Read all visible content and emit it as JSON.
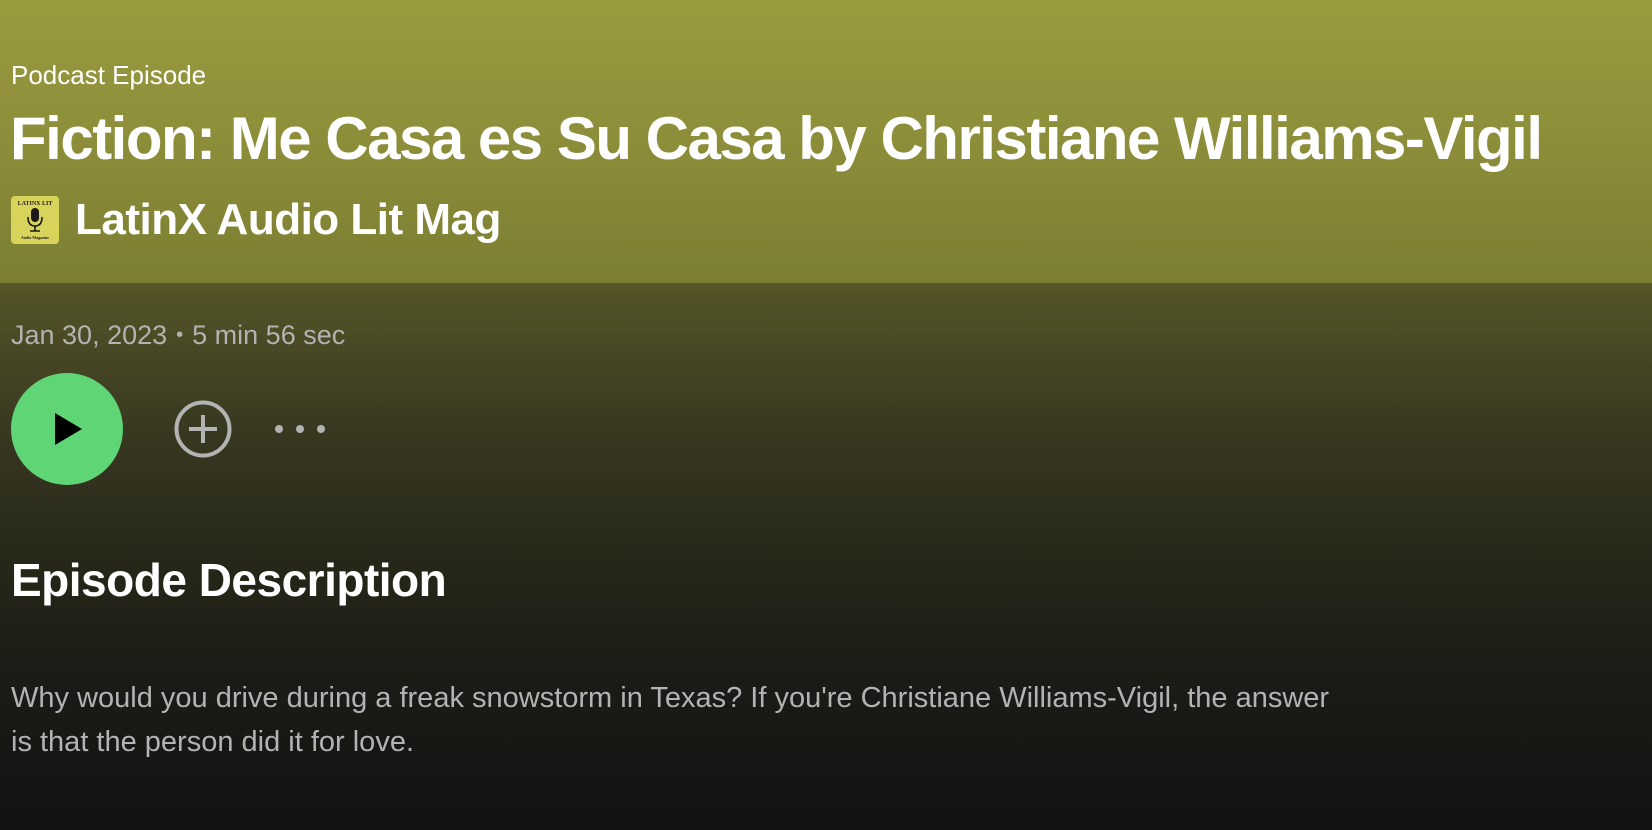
{
  "episode": {
    "eyebrow": "Podcast Episode",
    "title": "Fiction: Me Casa es Su Casa by Christiane Williams-Vigil",
    "show_name": "LatinX Audio Lit Mag",
    "show_art": {
      "top_text": "LATINX LIT",
      "bottom_text": "Audio Magazine",
      "icon": "microphone-icon",
      "background": "#d8d35a"
    },
    "date": "Jan 30, 2023",
    "separator": "•",
    "duration": "5 min 56 sec"
  },
  "controls": {
    "play_icon": "play-icon",
    "add_icon": "plus-circle-icon",
    "more_icon": "more-horizontal-icon",
    "play_color": "#5fd575"
  },
  "description": {
    "heading": "Episode Description",
    "text": "Why would you drive during a freak snowstorm in Texas? If you're Christiane Williams-Vigil, the answer is that the person did it for love."
  },
  "theme": {
    "header_color": "#9a9a3f",
    "background": "#121212",
    "muted_text": "#b3b3b3"
  }
}
